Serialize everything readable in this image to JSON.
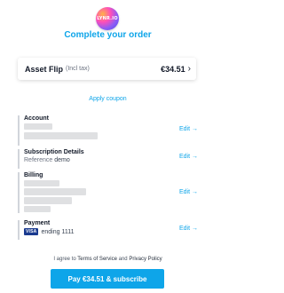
{
  "logo": {
    "text": "LYNR.IO"
  },
  "header": {
    "title": "Complete your order"
  },
  "product": {
    "name": "Asset Flip",
    "tax_note": "(Incl tax)",
    "price": "€34.51",
    "chevron": "›"
  },
  "coupon": {
    "label": "Apply coupon"
  },
  "sections": {
    "account": {
      "label": "Account",
      "edit": "Edit →"
    },
    "subscription": {
      "label": "Subscription Details",
      "reference_label": "Reference",
      "reference_value": "demo",
      "edit": "Edit →"
    },
    "billing": {
      "label": "Billing",
      "edit": "Edit →"
    },
    "payment": {
      "label": "Payment",
      "card_brand": "VISA",
      "card_text": "ending 1111",
      "edit": "Edit →"
    }
  },
  "legal": {
    "prefix": "I agree to",
    "terms": "Terms of Service",
    "and": "and",
    "privacy": "Privacy Policy"
  },
  "pay_button": {
    "label": "Pay €34.51 & subscribe"
  },
  "colors": {
    "accent": "#0ea5e9",
    "text": "#111827",
    "muted": "#6b7280",
    "divider": "#d1d5db"
  }
}
